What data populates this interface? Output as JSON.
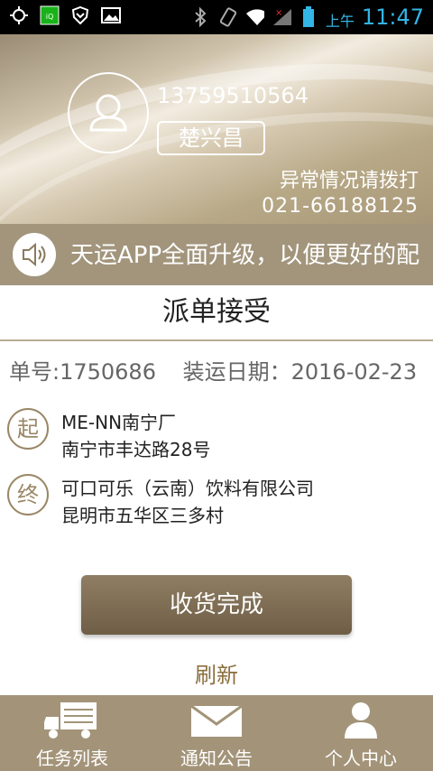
{
  "status_bar": {
    "ampm": "上午",
    "time": "11:47",
    "icons": [
      "gps-icon",
      "iqiyi-icon",
      "shield-icon",
      "image-icon",
      "bluetooth-icon",
      "vibrate-icon",
      "wifi-icon",
      "signal-icon",
      "battery-icon"
    ]
  },
  "profile": {
    "phone": "13759510564",
    "name": "楚兴昌",
    "hotline_label": "异常情况请拨打",
    "hotline_number": "021-66188125"
  },
  "notice": {
    "text": "天运APP全面升级，以便更好的配"
  },
  "order": {
    "title": "派单接受",
    "number_text": "单号:1750686",
    "date_text": "装运日期：2016-02-23",
    "start": {
      "badge": "起",
      "name": "ME-NN南宁厂",
      "address": "南宁市丰达路28号"
    },
    "end": {
      "badge": "终",
      "name": "可口可乐（云南）饮料有限公司",
      "address": "昆明市五华区三多村"
    },
    "complete_button": "收货完成",
    "refresh_link": "刷新"
  },
  "tabs": [
    {
      "label": "任务列表",
      "icon": "truck-icon"
    },
    {
      "label": "通知公告",
      "icon": "envelope-icon"
    },
    {
      "label": "个人中心",
      "icon": "person-icon"
    }
  ],
  "colors": {
    "accent_gold": "#9a8766",
    "tab_bar": "#a39479",
    "button": "#7c6b51",
    "status_time": "#33b5e5"
  }
}
